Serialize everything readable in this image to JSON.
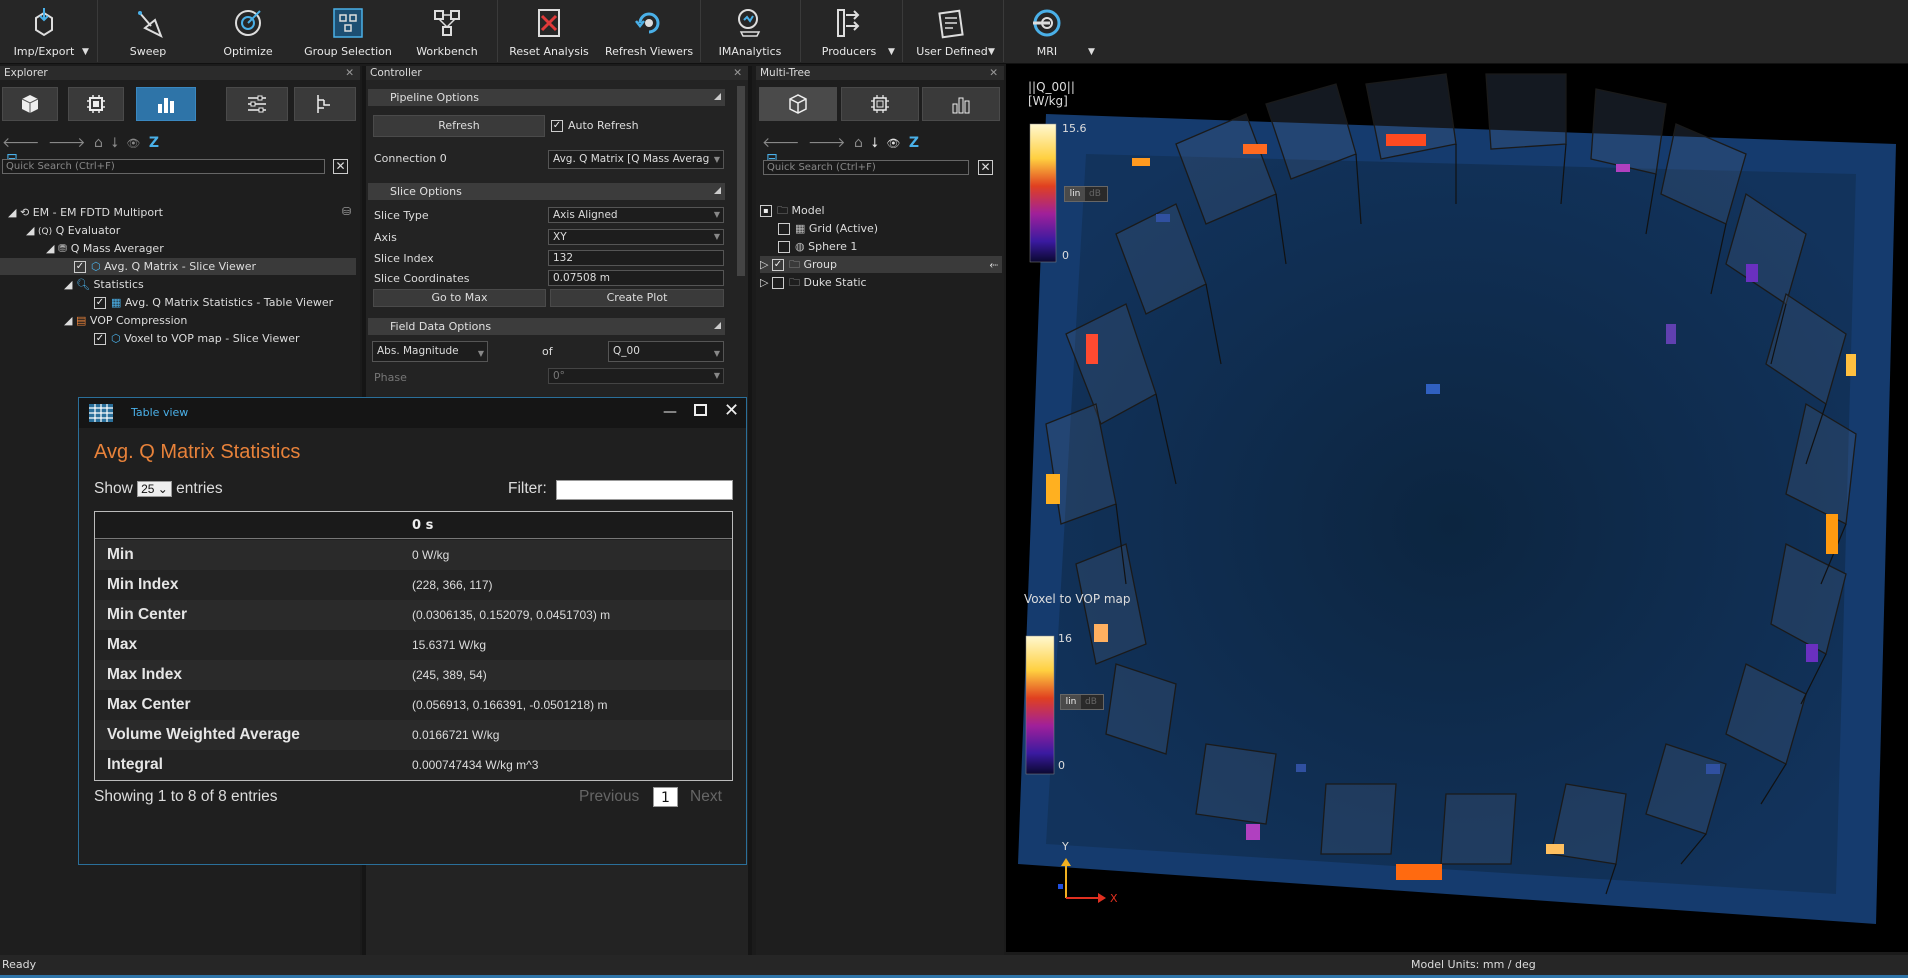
{
  "toolbar": {
    "buttons": [
      {
        "label": "Imp/Export",
        "icon": "import-export-icon"
      },
      {
        "label": "Sweep",
        "icon": "sweep-icon"
      },
      {
        "label": "Optimize",
        "icon": "target-icon"
      },
      {
        "label": "Group Selection",
        "icon": "group-selection-icon"
      },
      {
        "label": "Workbench",
        "icon": "workbench-icon"
      },
      {
        "label": "Reset Analysis",
        "icon": "reset-icon"
      },
      {
        "label": "Refresh Viewers",
        "icon": "refresh-icon"
      },
      {
        "label": "IMAnalytics",
        "icon": "analytics-icon"
      },
      {
        "label": "Producers",
        "icon": "producers-icon"
      },
      {
        "label": "User Defined",
        "icon": "user-defined-icon"
      },
      {
        "label": "MRI",
        "icon": "mri-icon"
      }
    ]
  },
  "explorer": {
    "title": "Explorer",
    "search_placeholder": "Quick Search (Ctrl+F)",
    "tree": [
      {
        "label": "EM - EM FDTD Multiport"
      },
      {
        "label": "Q Evaluator"
      },
      {
        "label": "Q Mass Averager"
      },
      {
        "label": "Avg. Q Matrix - Slice Viewer"
      },
      {
        "label": "Statistics"
      },
      {
        "label": "Avg. Q Matrix Statistics - Table Viewer"
      },
      {
        "label": "VOP Compression"
      },
      {
        "label": "Voxel to VOP map - Slice Viewer"
      }
    ]
  },
  "controller": {
    "title": "Controller",
    "pipeline_options": "Pipeline Options",
    "refresh": "Refresh",
    "auto_refresh": "Auto Refresh",
    "connection_label": "Connection 0",
    "connection_value": "Avg. Q Matrix [Q Mass Averag",
    "slice_options": "Slice Options",
    "slice_type_label": "Slice Type",
    "slice_type_value": "Axis Aligned",
    "axis_label": "Axis",
    "axis_value": "XY",
    "slice_index_label": "Slice Index",
    "slice_index_value": "132",
    "slice_coords_label": "Slice Coordinates",
    "slice_coords_value": "0.07508 m",
    "go_to_max": "Go to Max",
    "create_plot": "Create Plot",
    "field_data_options": "Field Data Options",
    "quantity_value": "Abs. Magnitude",
    "of_label": "of",
    "component_value": "Q_00",
    "phase_label": "Phase",
    "phase_value": "0°"
  },
  "multitree": {
    "title": "Multi-Tree",
    "search_placeholder": "Quick Search (Ctrl+F)",
    "items": [
      {
        "label": "Model"
      },
      {
        "label": "Grid (Active)"
      },
      {
        "label": "Sphere 1"
      },
      {
        "label": "Group"
      },
      {
        "label": "Duke Static"
      }
    ]
  },
  "table_view": {
    "window_title": "Table view",
    "heading": "Avg. Q Matrix Statistics",
    "show": "Show",
    "entries_select": "25",
    "entries": "entries",
    "filter": "Filter:",
    "column": "0 s",
    "rows": [
      {
        "key": "Min",
        "value": "0 W/kg"
      },
      {
        "key": "Min Index",
        "value": "(228, 366, 117)"
      },
      {
        "key": "Min Center",
        "value": "(0.0306135, 0.152079, 0.0451703) m"
      },
      {
        "key": "Max",
        "value": "15.6371 W/kg"
      },
      {
        "key": "Max Index",
        "value": "(245, 389, 54)"
      },
      {
        "key": "Max Center",
        "value": "(0.056913, 0.166391, -0.0501218) m"
      },
      {
        "key": "Volume Weighted Average",
        "value": "0.0166721 W/kg"
      },
      {
        "key": "Integral",
        "value": "0.000747434 W/kg m^3"
      }
    ],
    "footer": "Showing 1 to 8 of 8 entries",
    "previous": "Previous",
    "page": "1",
    "next": "Next"
  },
  "viewer": {
    "legend1_title": "||Q_00||",
    "legend1_unit": "[W/kg]",
    "legend1_max": "15.6",
    "legend1_min": "0",
    "lin": "lin",
    "db": "dB",
    "legend2_title": "Voxel to VOP map",
    "legend2_max": "16",
    "legend2_min": "0",
    "axis_y": "Y",
    "axis_x": "X"
  },
  "status": {
    "left": "Ready",
    "right": "Model Units: mm / deg"
  },
  "colors": {
    "accent": "#e8823a",
    "highlight": "#2e74a8",
    "bg": "#1b1b1b"
  }
}
